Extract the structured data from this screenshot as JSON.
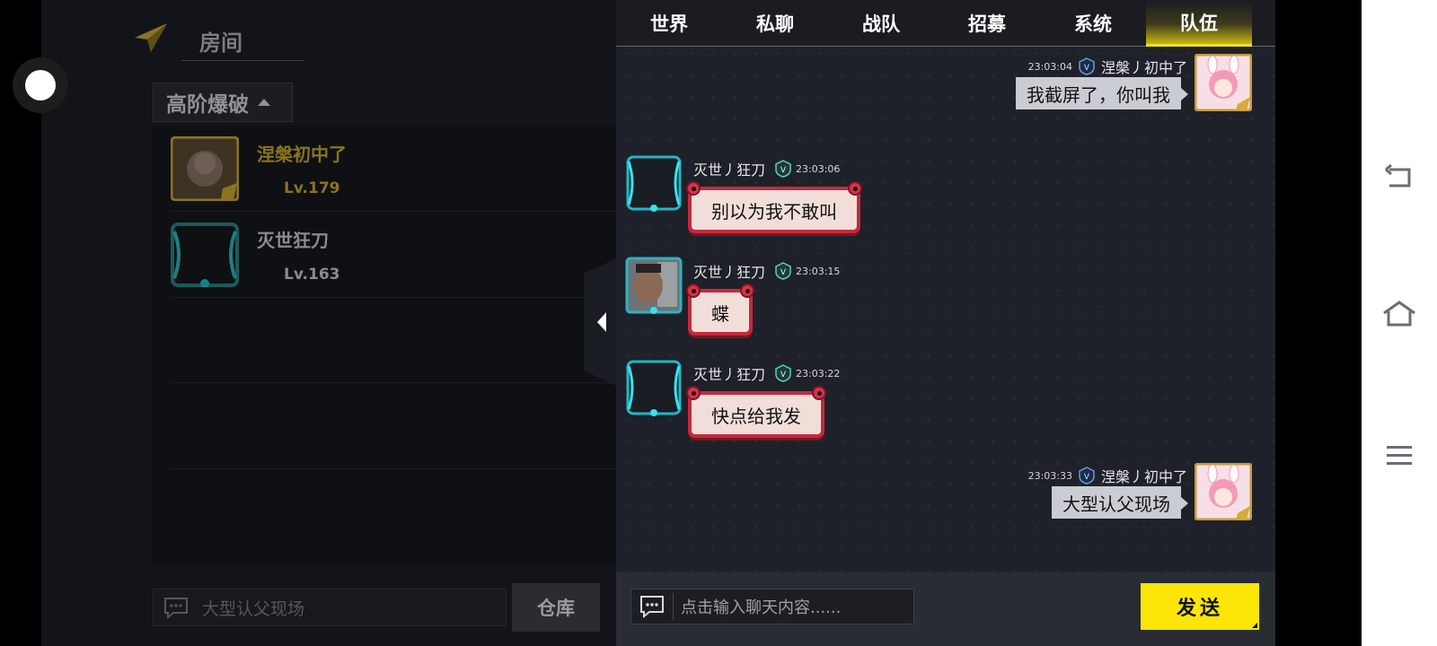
{
  "room": {
    "title": "房间",
    "mode": "高阶爆破",
    "players": [
      {
        "name": "涅槃初中了",
        "level": "Lv.179",
        "name_color": "#8a7420",
        "level_color": "#8a7420"
      },
      {
        "name": "灭世狂刀",
        "level": "Lv.163",
        "name_color": "#8a8c92",
        "level_color": "#8a8c92"
      }
    ],
    "input_text": "大型认父现场",
    "warehouse_label": "仓库"
  },
  "chat": {
    "tabs": [
      "世界",
      "私聊",
      "战队",
      "招募",
      "系统",
      "队伍"
    ],
    "active_tab": "队伍",
    "messages": [
      {
        "side": "right",
        "time": "23:03:04",
        "name": "涅槃丿初中了",
        "text": "我截屏了，你叫我",
        "bubble": "plain",
        "avatar": "anime-avatar"
      },
      {
        "side": "left",
        "time": "23:03:06",
        "name": "灭世丿狂刀",
        "text": "别以为我不敢叫",
        "bubble": "fancy",
        "avatar": "frame-avatar"
      },
      {
        "side": "left",
        "time": "23:03:15",
        "name": "灭世丿狂刀",
        "text": "蝶",
        "bubble": "fancy",
        "avatar": "photo-avatar"
      },
      {
        "side": "left",
        "time": "23:03:22",
        "name": "灭世丿狂刀",
        "text": "快点给我发",
        "bubble": "fancy",
        "avatar": "frame-avatar"
      },
      {
        "side": "right",
        "time": "23:03:33",
        "name": "涅槃丿初中了",
        "text": "大型认父现场",
        "bubble": "plain",
        "avatar": "anime-avatar"
      }
    ],
    "input_placeholder": "点击输入聊天内容......",
    "send_label": "发送"
  },
  "colors": {
    "accent": "#fce608",
    "panel": "#1e2129",
    "fancy_border": "#c22b3e",
    "plain_bubble": "#c9ccd2"
  }
}
